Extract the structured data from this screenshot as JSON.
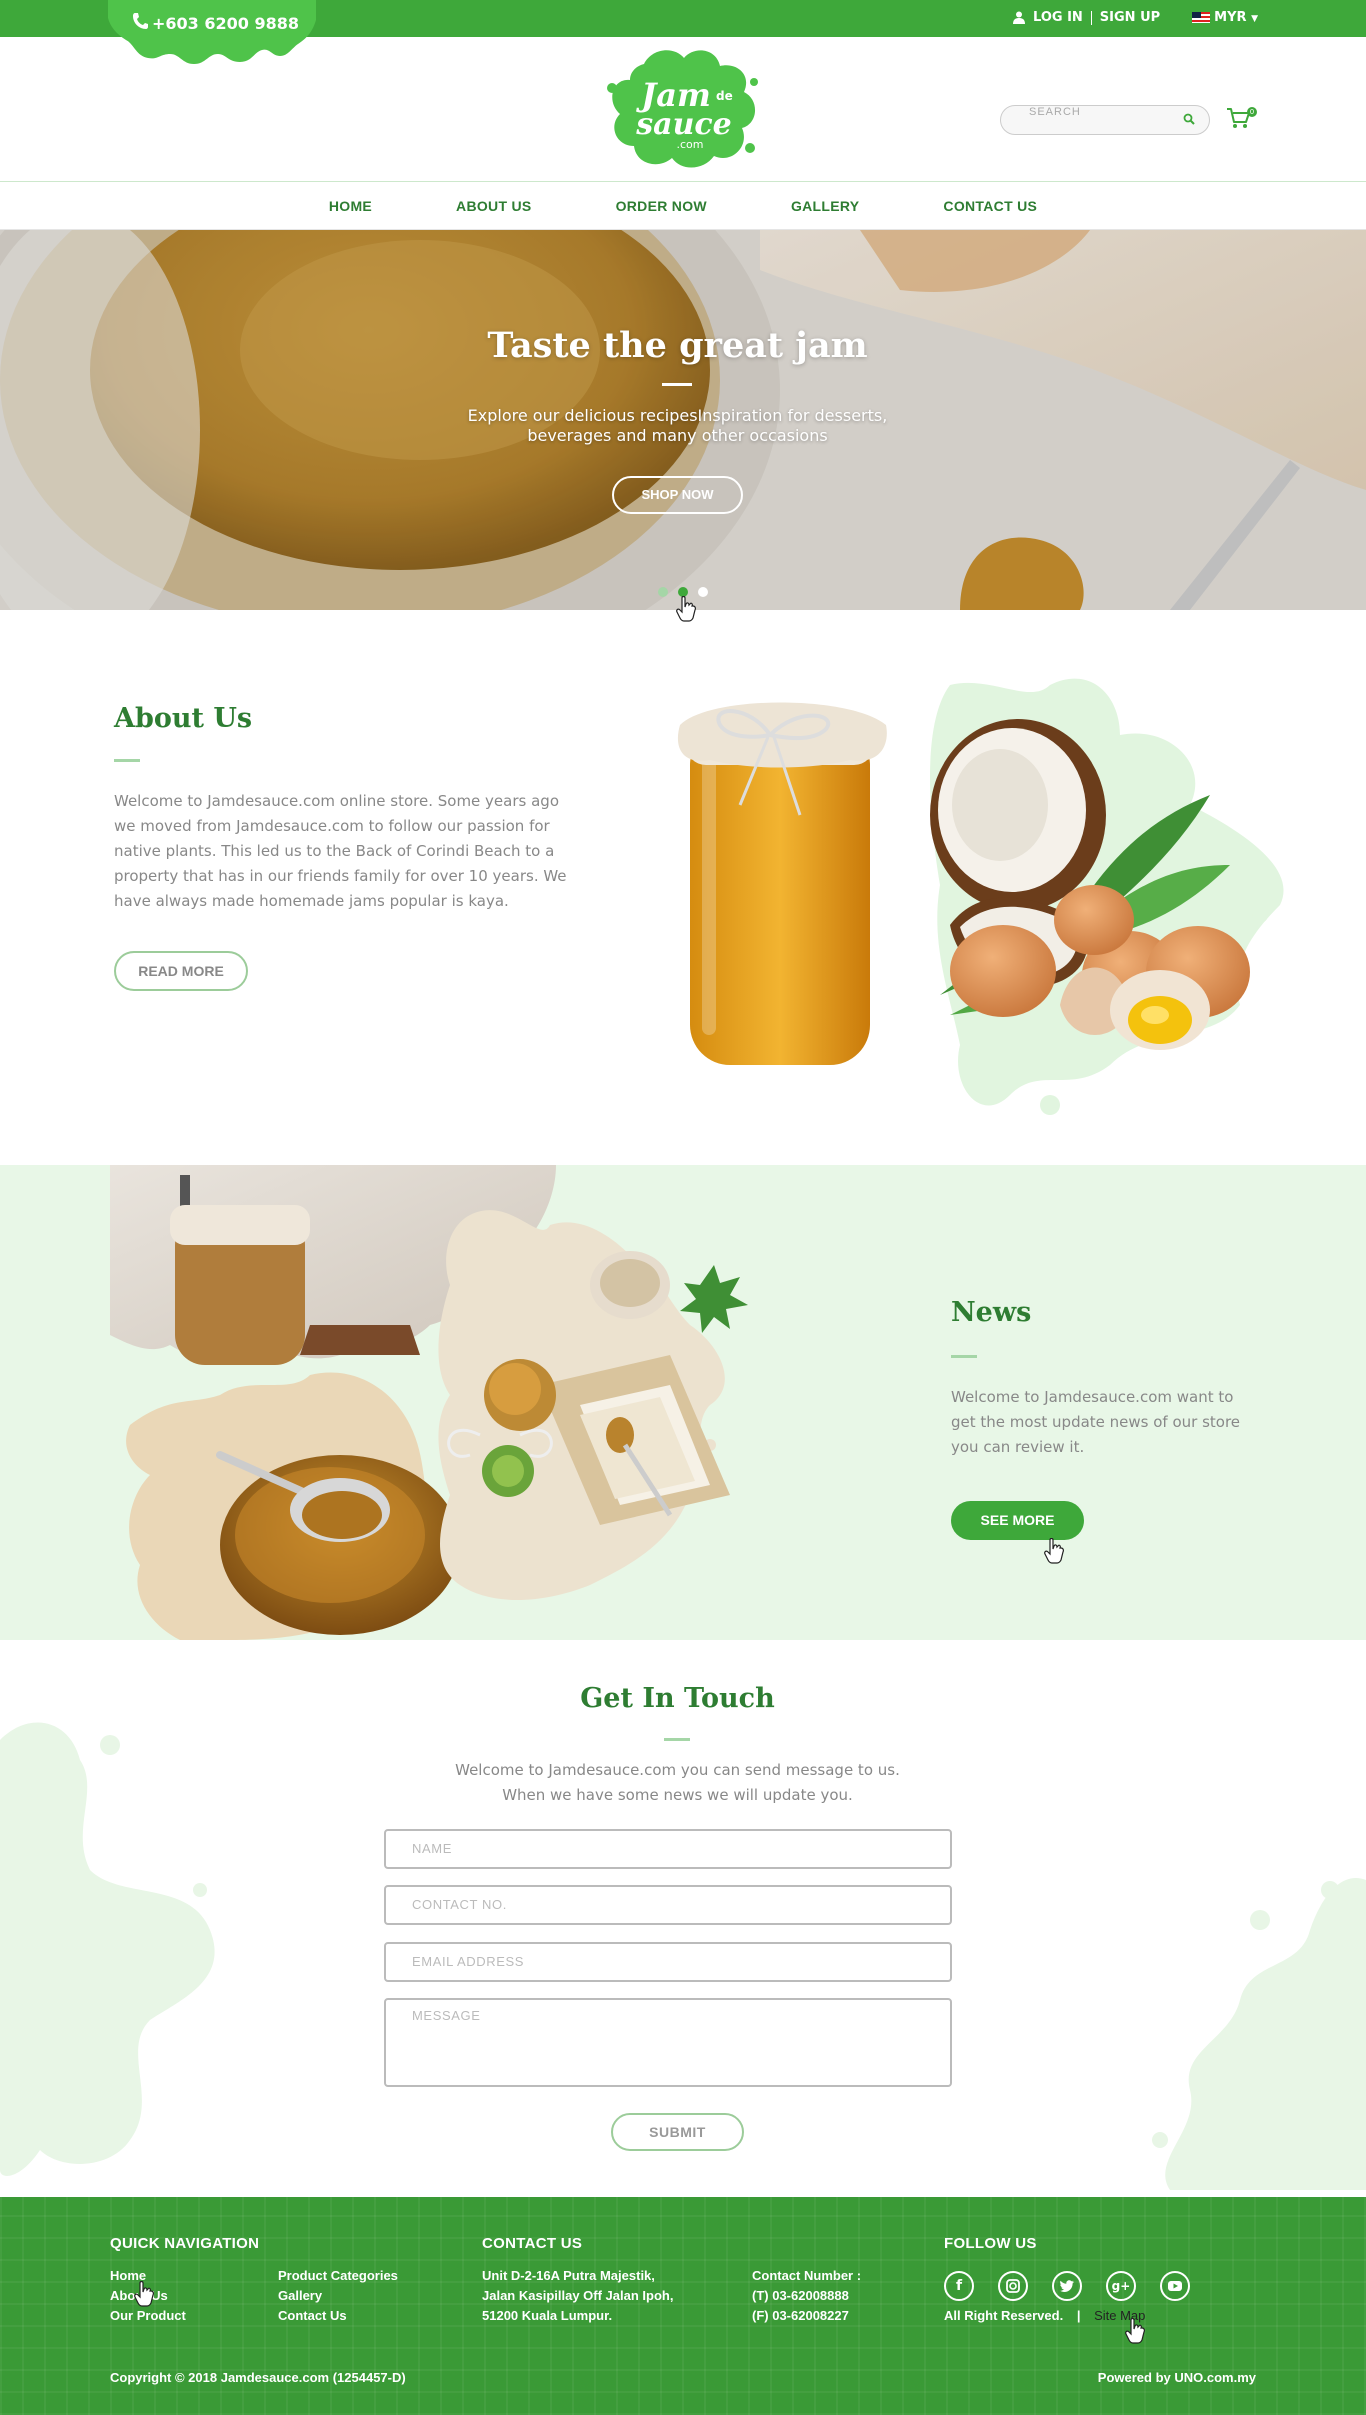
{
  "topbar": {
    "phone": "+603 6200 9888",
    "login": "LOG IN",
    "signup": "SIGN UP",
    "currency": "MYR",
    "brand_color": "#3ea83a"
  },
  "header": {
    "logo_text": "Jam de sauce .com",
    "search_placeholder": "SEARCH",
    "cart_count": "0"
  },
  "nav": {
    "items": [
      "HOME",
      "ABOUT US",
      "ORDER NOW",
      "GALLERY",
      "CONTACT US"
    ]
  },
  "hero": {
    "title": "Taste the great jam",
    "subtitle_line1": "Explore our delicious recipesInspiration for desserts,",
    "subtitle_line2": "beverages and many other occasions",
    "button": "SHOP NOW",
    "slides_count": 3,
    "active_slide": 2
  },
  "about": {
    "title": "About Us",
    "text": "Welcome to Jamdesauce.com online store. Some years ago we moved from Jamdesauce.com to follow our passion for native plants. This led us to the Back of Corindi Beach to a property that has in our friends family for over 10 years. We have always made homemade jams popular is kaya.",
    "button": "READ MORE"
  },
  "news": {
    "title": "News",
    "text": "Welcome to Jamdesauce.com want to get the most update news of our store you can review it.",
    "button": "SEE MORE"
  },
  "contact": {
    "title": "Get In Touch",
    "text_line1": "Welcome to Jamdesauce.com you can send message to us.",
    "text_line2": "When we have some news we will update you.",
    "name_placeholder": "NAME",
    "contact_placeholder": "CONTACT NO.",
    "email_placeholder": "EMAIL ADDRESS",
    "message_placeholder": "MESSAGE",
    "submit": "SUBMIT"
  },
  "footer": {
    "nav_title": "QUICK NAVIGATION",
    "nav_links": [
      "Home",
      "About Us",
      "Our Product",
      "Product Categories",
      "Gallery",
      "Contact Us"
    ],
    "contact_title": "CONTACT US",
    "address": [
      "Unit D-2-16A Putra Majestik,",
      "Jalan Kasipillay Off Jalan Ipoh,",
      "51200 Kuala Lumpur."
    ],
    "numbers": [
      "Contact Number :",
      "(T) 03-62008888",
      "(F) 03-62008227"
    ],
    "follow_title": "FOLLOW US",
    "social": [
      "facebook-icon",
      "instagram-icon",
      "twitter-icon",
      "google-plus-icon",
      "youtube-icon"
    ],
    "rights": "All Right Reserved.",
    "sitemap": "Site Map",
    "copyright": "Copyright © 2018 Jamdesauce.com (1254457-D)",
    "powered": "Powered by UNO.com.my"
  }
}
